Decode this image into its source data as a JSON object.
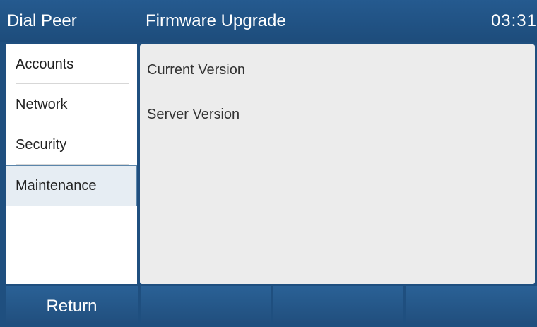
{
  "topbar": {
    "left_label": "Dial Peer",
    "title": "Firmware Upgrade",
    "time": "03:31"
  },
  "sidebar": {
    "items": [
      {
        "label": "Accounts"
      },
      {
        "label": "Network"
      },
      {
        "label": "Security"
      },
      {
        "label": "Maintenance"
      }
    ]
  },
  "panel": {
    "current_version_label": "Current Version",
    "server_version_label": "Server Version"
  },
  "softkeys": {
    "key1": "Return",
    "key2": "",
    "key3": "",
    "key4": ""
  },
  "colors": {
    "background": "#1f4f7f",
    "active_item": "#e6edf3",
    "panel": "#ececec"
  }
}
